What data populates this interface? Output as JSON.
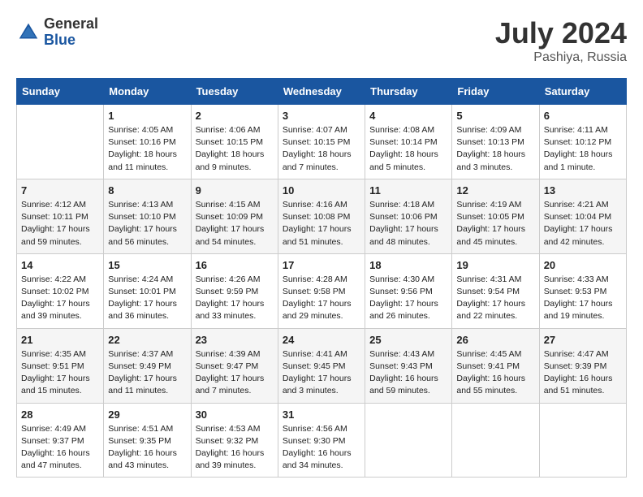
{
  "header": {
    "logo_general": "General",
    "logo_blue": "Blue",
    "month_title": "July 2024",
    "location": "Pashiya, Russia"
  },
  "weekdays": [
    "Sunday",
    "Monday",
    "Tuesday",
    "Wednesday",
    "Thursday",
    "Friday",
    "Saturday"
  ],
  "weeks": [
    [
      {
        "day": "",
        "sunrise": "",
        "sunset": "",
        "daylight": ""
      },
      {
        "day": "1",
        "sunrise": "Sunrise: 4:05 AM",
        "sunset": "Sunset: 10:16 PM",
        "daylight": "Daylight: 18 hours and 11 minutes."
      },
      {
        "day": "2",
        "sunrise": "Sunrise: 4:06 AM",
        "sunset": "Sunset: 10:15 PM",
        "daylight": "Daylight: 18 hours and 9 minutes."
      },
      {
        "day": "3",
        "sunrise": "Sunrise: 4:07 AM",
        "sunset": "Sunset: 10:15 PM",
        "daylight": "Daylight: 18 hours and 7 minutes."
      },
      {
        "day": "4",
        "sunrise": "Sunrise: 4:08 AM",
        "sunset": "Sunset: 10:14 PM",
        "daylight": "Daylight: 18 hours and 5 minutes."
      },
      {
        "day": "5",
        "sunrise": "Sunrise: 4:09 AM",
        "sunset": "Sunset: 10:13 PM",
        "daylight": "Daylight: 18 hours and 3 minutes."
      },
      {
        "day": "6",
        "sunrise": "Sunrise: 4:11 AM",
        "sunset": "Sunset: 10:12 PM",
        "daylight": "Daylight: 18 hours and 1 minute."
      }
    ],
    [
      {
        "day": "7",
        "sunrise": "Sunrise: 4:12 AM",
        "sunset": "Sunset: 10:11 PM",
        "daylight": "Daylight: 17 hours and 59 minutes."
      },
      {
        "day": "8",
        "sunrise": "Sunrise: 4:13 AM",
        "sunset": "Sunset: 10:10 PM",
        "daylight": "Daylight: 17 hours and 56 minutes."
      },
      {
        "day": "9",
        "sunrise": "Sunrise: 4:15 AM",
        "sunset": "Sunset: 10:09 PM",
        "daylight": "Daylight: 17 hours and 54 minutes."
      },
      {
        "day": "10",
        "sunrise": "Sunrise: 4:16 AM",
        "sunset": "Sunset: 10:08 PM",
        "daylight": "Daylight: 17 hours and 51 minutes."
      },
      {
        "day": "11",
        "sunrise": "Sunrise: 4:18 AM",
        "sunset": "Sunset: 10:06 PM",
        "daylight": "Daylight: 17 hours and 48 minutes."
      },
      {
        "day": "12",
        "sunrise": "Sunrise: 4:19 AM",
        "sunset": "Sunset: 10:05 PM",
        "daylight": "Daylight: 17 hours and 45 minutes."
      },
      {
        "day": "13",
        "sunrise": "Sunrise: 4:21 AM",
        "sunset": "Sunset: 10:04 PM",
        "daylight": "Daylight: 17 hours and 42 minutes."
      }
    ],
    [
      {
        "day": "14",
        "sunrise": "Sunrise: 4:22 AM",
        "sunset": "Sunset: 10:02 PM",
        "daylight": "Daylight: 17 hours and 39 minutes."
      },
      {
        "day": "15",
        "sunrise": "Sunrise: 4:24 AM",
        "sunset": "Sunset: 10:01 PM",
        "daylight": "Daylight: 17 hours and 36 minutes."
      },
      {
        "day": "16",
        "sunrise": "Sunrise: 4:26 AM",
        "sunset": "Sunset: 9:59 PM",
        "daylight": "Daylight: 17 hours and 33 minutes."
      },
      {
        "day": "17",
        "sunrise": "Sunrise: 4:28 AM",
        "sunset": "Sunset: 9:58 PM",
        "daylight": "Daylight: 17 hours and 29 minutes."
      },
      {
        "day": "18",
        "sunrise": "Sunrise: 4:30 AM",
        "sunset": "Sunset: 9:56 PM",
        "daylight": "Daylight: 17 hours and 26 minutes."
      },
      {
        "day": "19",
        "sunrise": "Sunrise: 4:31 AM",
        "sunset": "Sunset: 9:54 PM",
        "daylight": "Daylight: 17 hours and 22 minutes."
      },
      {
        "day": "20",
        "sunrise": "Sunrise: 4:33 AM",
        "sunset": "Sunset: 9:53 PM",
        "daylight": "Daylight: 17 hours and 19 minutes."
      }
    ],
    [
      {
        "day": "21",
        "sunrise": "Sunrise: 4:35 AM",
        "sunset": "Sunset: 9:51 PM",
        "daylight": "Daylight: 17 hours and 15 minutes."
      },
      {
        "day": "22",
        "sunrise": "Sunrise: 4:37 AM",
        "sunset": "Sunset: 9:49 PM",
        "daylight": "Daylight: 17 hours and 11 minutes."
      },
      {
        "day": "23",
        "sunrise": "Sunrise: 4:39 AM",
        "sunset": "Sunset: 9:47 PM",
        "daylight": "Daylight: 17 hours and 7 minutes."
      },
      {
        "day": "24",
        "sunrise": "Sunrise: 4:41 AM",
        "sunset": "Sunset: 9:45 PM",
        "daylight": "Daylight: 17 hours and 3 minutes."
      },
      {
        "day": "25",
        "sunrise": "Sunrise: 4:43 AM",
        "sunset": "Sunset: 9:43 PM",
        "daylight": "Daylight: 16 hours and 59 minutes."
      },
      {
        "day": "26",
        "sunrise": "Sunrise: 4:45 AM",
        "sunset": "Sunset: 9:41 PM",
        "daylight": "Daylight: 16 hours and 55 minutes."
      },
      {
        "day": "27",
        "sunrise": "Sunrise: 4:47 AM",
        "sunset": "Sunset: 9:39 PM",
        "daylight": "Daylight: 16 hours and 51 minutes."
      }
    ],
    [
      {
        "day": "28",
        "sunrise": "Sunrise: 4:49 AM",
        "sunset": "Sunset: 9:37 PM",
        "daylight": "Daylight: 16 hours and 47 minutes."
      },
      {
        "day": "29",
        "sunrise": "Sunrise: 4:51 AM",
        "sunset": "Sunset: 9:35 PM",
        "daylight": "Daylight: 16 hours and 43 minutes."
      },
      {
        "day": "30",
        "sunrise": "Sunrise: 4:53 AM",
        "sunset": "Sunset: 9:32 PM",
        "daylight": "Daylight: 16 hours and 39 minutes."
      },
      {
        "day": "31",
        "sunrise": "Sunrise: 4:56 AM",
        "sunset": "Sunset: 9:30 PM",
        "daylight": "Daylight: 16 hours and 34 minutes."
      },
      {
        "day": "",
        "sunrise": "",
        "sunset": "",
        "daylight": ""
      },
      {
        "day": "",
        "sunrise": "",
        "sunset": "",
        "daylight": ""
      },
      {
        "day": "",
        "sunrise": "",
        "sunset": "",
        "daylight": ""
      }
    ]
  ]
}
